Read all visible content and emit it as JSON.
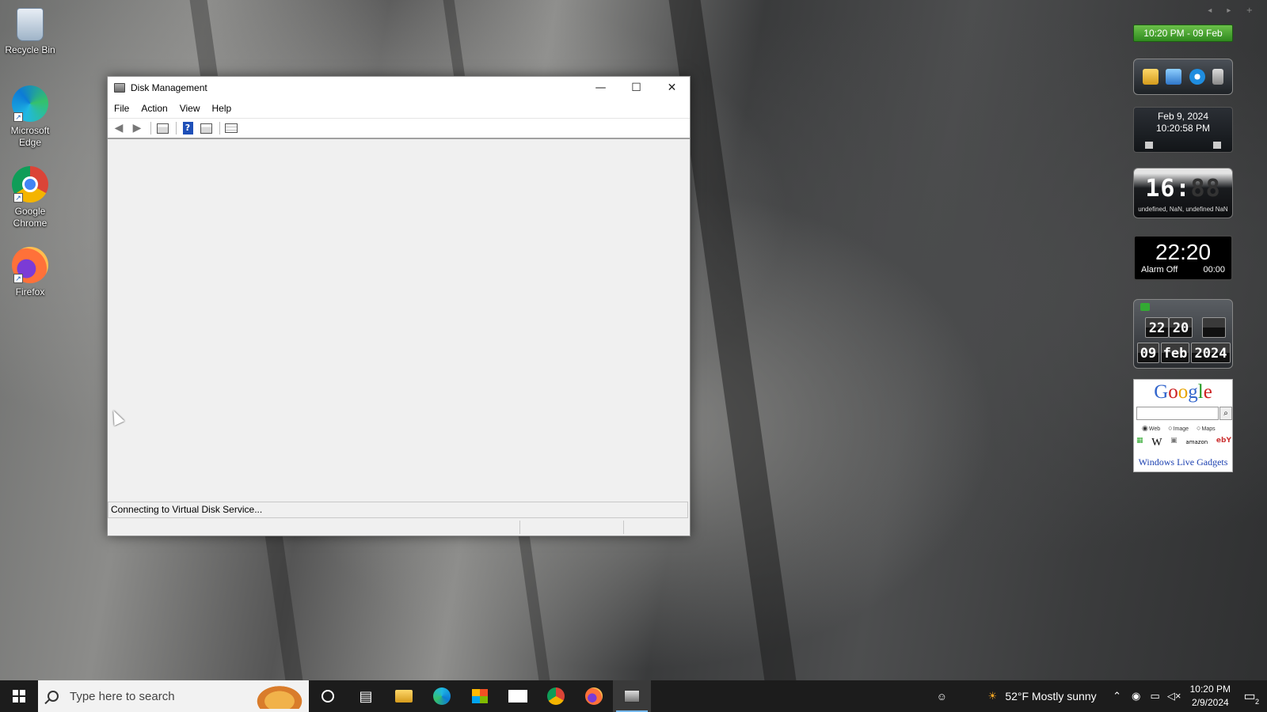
{
  "desktop": {
    "icons": [
      {
        "label": "Recycle Bin"
      },
      {
        "label": "Microsoft Edge"
      },
      {
        "label": "Google Chrome"
      },
      {
        "label": "Firefox"
      }
    ]
  },
  "window": {
    "title": "Disk Management",
    "controls": {
      "minimize": "—",
      "maximize": "☐",
      "close": "✕"
    },
    "menu": [
      "File",
      "Action",
      "View",
      "Help"
    ],
    "toolbar": {
      "back_icon": "back-arrow-icon",
      "forward_icon": "forward-arrow-icon",
      "help_glyph": "?"
    },
    "status_text": "Connecting to Virtual Disk Service..."
  },
  "gadgets": {
    "nav": "◂ ▸ +",
    "clock_bar": "10:20 PM - 09 Feb",
    "date_gadget": {
      "date": "Feb 9, 2024",
      "time": "10:20:58 PM"
    },
    "digital_clock": {
      "display": "16:",
      "dim_digits": "88",
      "subtitle": "undefined, NaN, undefined NaN"
    },
    "alarm_clock": {
      "time": "22:20",
      "status": "Alarm Off",
      "alarm_time": "00:00"
    },
    "flip_clock": {
      "hour": "22",
      "minute": "20",
      "day": "09",
      "month": "feb",
      "year": "2024"
    },
    "google": {
      "logo_letters": [
        "G",
        "o",
        "o",
        "g",
        "l",
        "e"
      ],
      "logo_colors": [
        "#3366cc",
        "#cc2222",
        "#e8a400",
        "#3366cc",
        "#229922",
        "#cc2222"
      ],
      "radio_options": [
        "Web",
        "Image",
        "Maps"
      ],
      "selected_radio": "Web",
      "sites": [
        "W",
        "amazon",
        "ebY"
      ],
      "footer_link": "Windows Live Gadgets"
    }
  },
  "taskbar": {
    "search_placeholder": "Type here to search",
    "weather": "52°F  Mostly sunny",
    "clock_time": "10:20 PM",
    "clock_date": "2/9/2024",
    "notification_count": "2"
  },
  "colors": {
    "taskbar_bg": "#1c1c1c",
    "gadget_clock_green": "#3fa52a",
    "active_app_underline": "#76b9ed"
  }
}
